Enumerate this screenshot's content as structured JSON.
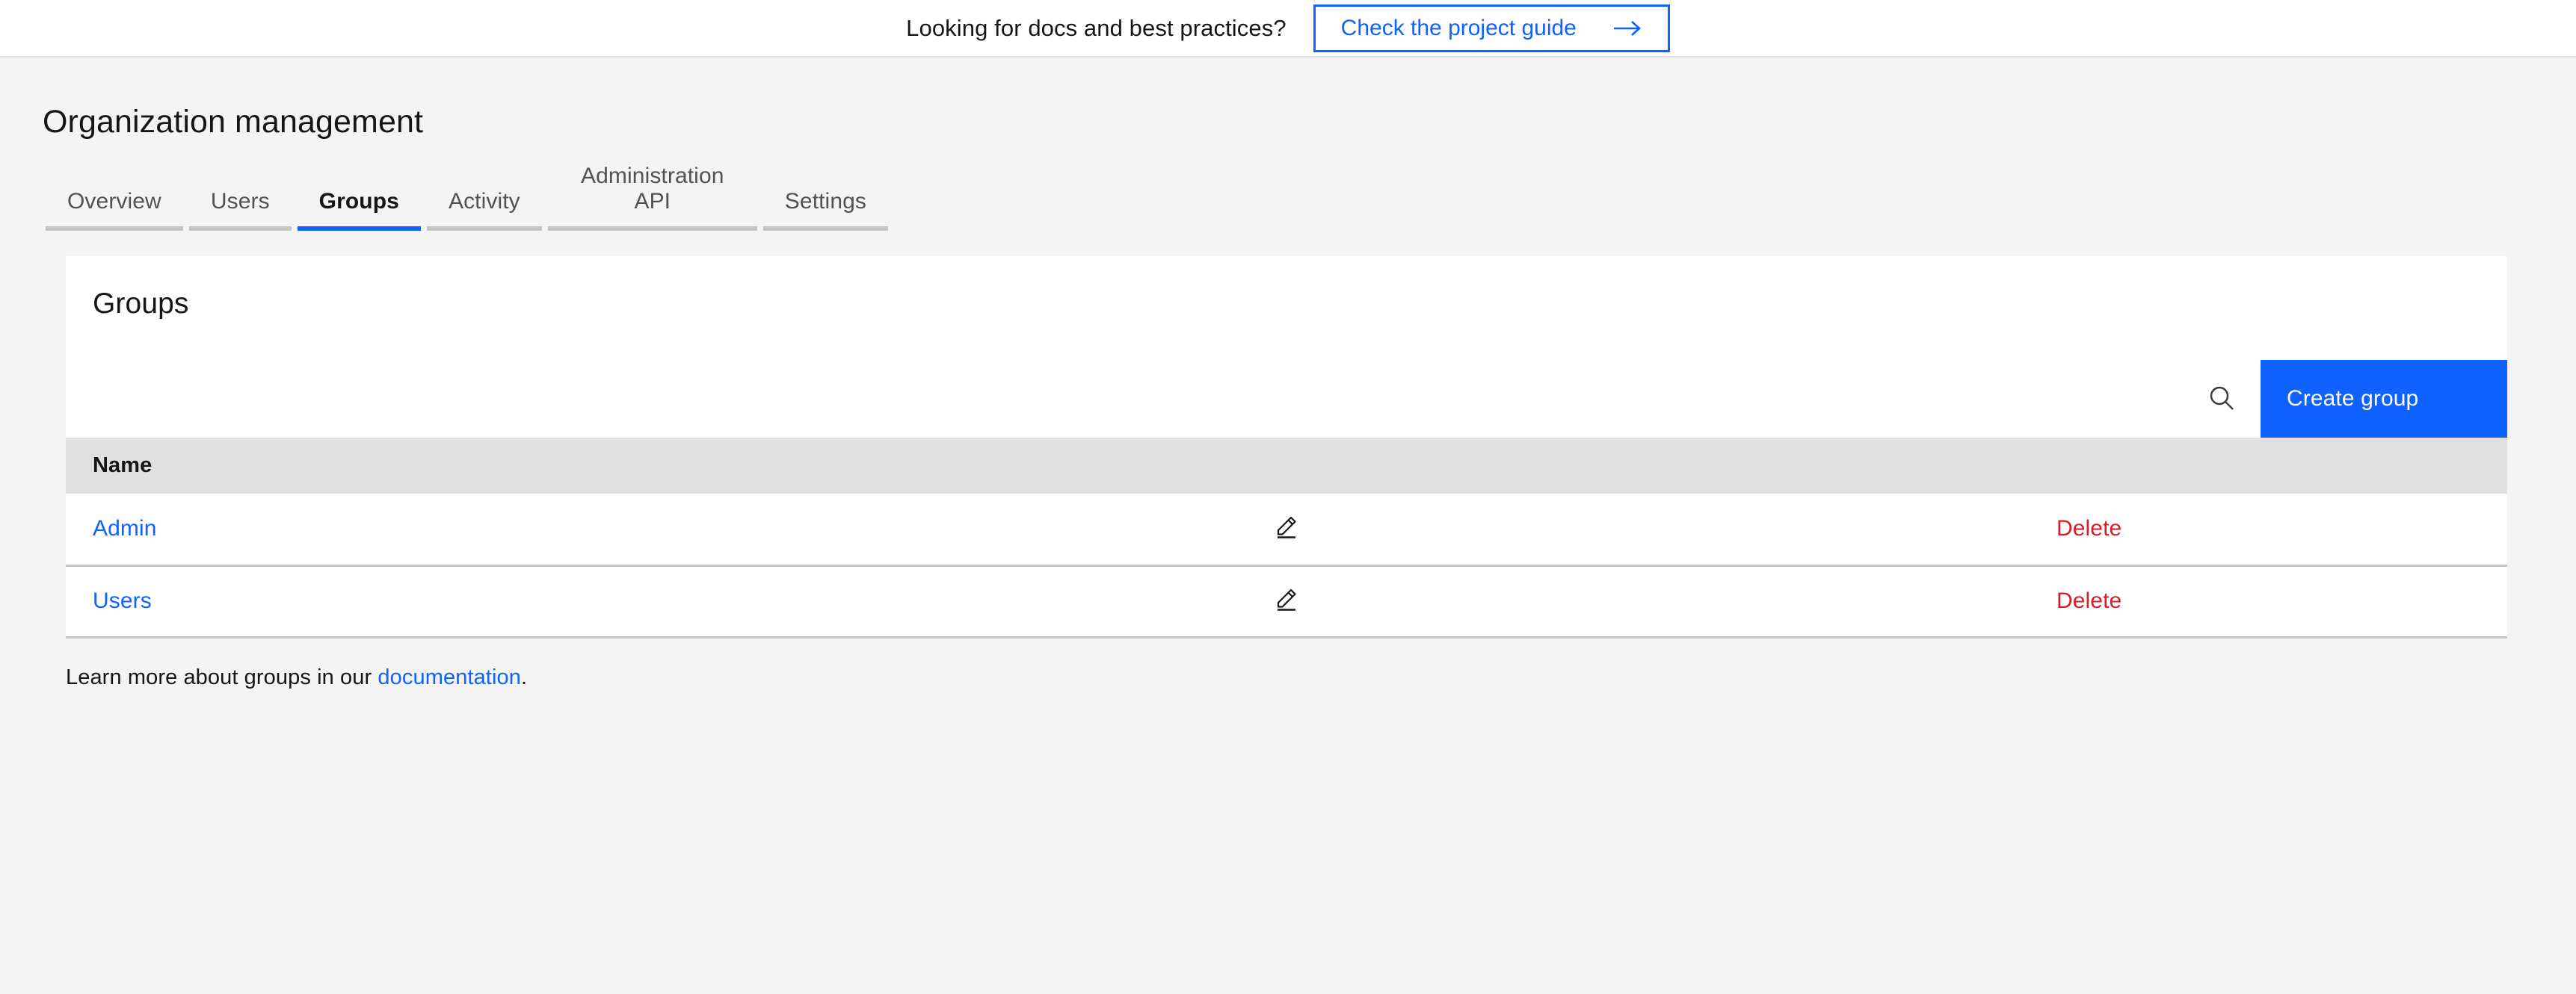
{
  "banner": {
    "message": "Looking for docs and best practices?",
    "cta_label": "Check the project guide",
    "arrow_icon": "arrow-right-icon",
    "accent_color": "#0f62fe"
  },
  "page": {
    "title": "Organization management"
  },
  "tabs": [
    {
      "label": "Overview",
      "active": false
    },
    {
      "label": "Users",
      "active": false
    },
    {
      "label": "Groups",
      "active": true
    },
    {
      "label": "Activity",
      "active": false
    },
    {
      "label": "Administration API",
      "active": false
    },
    {
      "label": "Settings",
      "active": false
    }
  ],
  "card": {
    "title": "Groups",
    "toolbar": {
      "search_icon": "search-icon",
      "create_label": "Create group"
    },
    "table": {
      "columns": [
        "Name"
      ],
      "rows": [
        {
          "name": "Admin",
          "edit_icon": "pencil-edit-icon",
          "delete_label": "Delete"
        },
        {
          "name": "Users",
          "edit_icon": "pencil-edit-icon",
          "delete_label": "Delete"
        }
      ]
    }
  },
  "footer": {
    "prefix": "Learn more about groups in our ",
    "link_label": "documentation",
    "suffix": "."
  },
  "colors": {
    "accent_blue": "#0f62fe",
    "danger_red": "#da1e28",
    "page_bg": "#f4f4f4",
    "table_header_bg": "#e0e0e0",
    "border_gray": "#c6c6c6"
  }
}
